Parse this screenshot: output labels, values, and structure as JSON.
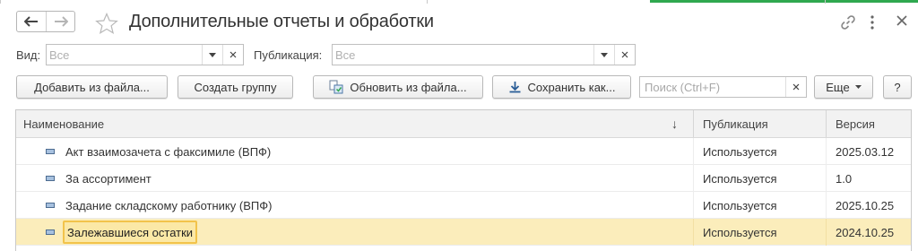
{
  "window": {
    "title": "Дополнительные отчеты и обработки",
    "accent_color": "#2fa84f"
  },
  "filters": {
    "view_label": "Вид:",
    "view_value": "Все",
    "publication_label": "Публикация:",
    "publication_value": "Все"
  },
  "toolbar": {
    "add_from_file": "Добавить из файла...",
    "create_group": "Создать группу",
    "update_from_file": "Обновить из файла...",
    "save_as": "Сохранить как...",
    "search_placeholder": "Поиск (Ctrl+F)",
    "more": "Еще",
    "help": "?"
  },
  "table": {
    "columns": [
      "Наименование",
      "Публикация",
      "Версия"
    ],
    "rows": [
      {
        "name": "Акт взаимозачета с факсимиле (ВПФ)",
        "publication": "Используется",
        "version": "2025.03.12"
      },
      {
        "name": "За ассортимент",
        "publication": "Используется",
        "version": "1.0"
      },
      {
        "name": "Задание складскому работнику (ВПФ)",
        "publication": "Используется",
        "version": "2025.10.25"
      },
      {
        "name": "Залежавшиеся остатки",
        "publication": "Используется",
        "version": "2024.10.25",
        "selected": true
      }
    ],
    "selected_row_color": "#fbedbb"
  }
}
